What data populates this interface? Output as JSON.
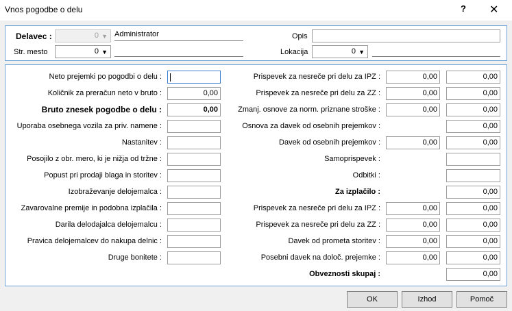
{
  "window": {
    "title": "Vnos pogodbe o delu",
    "help": "?",
    "close": "✕"
  },
  "header": {
    "delavec_label": "Delavec :",
    "delavec_value": "0",
    "delavec_name": "Administrator",
    "opis_label": "Opis",
    "opis_value": "",
    "str_mesto_label": "Str. mesto",
    "str_mesto_value": "0",
    "str_mesto_name": "",
    "lokacija_label": "Lokacija",
    "lokacija_value": "0",
    "lokacija_name": ""
  },
  "left": [
    {
      "label": "Neto prejemki po pogodbi o delu :",
      "value": ""
    },
    {
      "label": "Količnik za preračun neto v bruto :",
      "value": "0,00"
    },
    {
      "label": "Bruto znesek pogodbe o delu :",
      "value": "0,00"
    },
    {
      "label": "Uporaba osebnega vozila  za priv. namene :",
      "value": ""
    },
    {
      "label": "Nastanitev :",
      "value": ""
    },
    {
      "label": "Posojilo z obr. mero, ki je nižja od tržne :",
      "value": ""
    },
    {
      "label": "Popust pri prodaji blaga in storitev :",
      "value": ""
    },
    {
      "label": "Izobraževanje delojemalca :",
      "value": ""
    },
    {
      "label": "Zavarovalne premije in podobna izplačila :",
      "value": ""
    },
    {
      "label": "Darila delodajalca delojemalcu :",
      "value": ""
    },
    {
      "label": "Pravica delojemalcev do nakupa delnic :",
      "value": ""
    },
    {
      "label": "Druge bonitete :",
      "value": ""
    }
  ],
  "right": [
    {
      "label": "Prispevek za nesreče pri delu za IPZ :",
      "value1": "0,00",
      "value2": "0,00"
    },
    {
      "label": "Prispevek za nesreče pri delu za ZZ :",
      "value1": "0,00",
      "value2": "0,00"
    },
    {
      "label": "Zmanj. osnove za norm. priznane stroške :",
      "value1": "0,00",
      "value2": "0,00"
    },
    {
      "label": "Osnova za davek od osebnih prejemkov :",
      "value2": "0,00"
    },
    {
      "label": "Davek od osebnih prejemkov :",
      "value1": "0,00",
      "value2": "0,00"
    },
    {
      "label": "Samoprispevek :",
      "value2": ""
    },
    {
      "label": "Odbitki :",
      "value2": ""
    },
    {
      "label": "Za izplačilo :",
      "value2": "0,00"
    },
    {
      "label": "Prispevek za nesreče pri delu za IPZ :",
      "value1": "0,00",
      "value2": "0,00"
    },
    {
      "label": "Prispevek za nesreče pri delu za ZZ :",
      "value1": "0,00",
      "value2": "0,00"
    },
    {
      "label": "Davek od prometa storitev :",
      "value1": "0,00",
      "value2": "0,00"
    },
    {
      "label": "Posebni davek na določ. prejemke :",
      "value1": "0,00",
      "value2": "0,00"
    },
    {
      "label": "Obveznosti skupaj :",
      "value2": "0,00"
    }
  ],
  "buttons": {
    "ok": "OK",
    "izhod": "Izhod",
    "pomoc": "Pomoč"
  }
}
